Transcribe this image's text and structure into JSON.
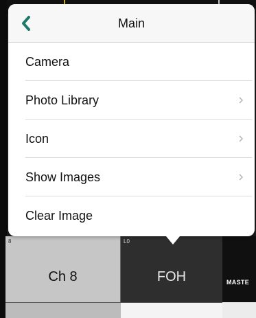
{
  "popover": {
    "title": "Main",
    "items": [
      {
        "label": "Camera",
        "has_submenu": false
      },
      {
        "label": "Photo Library",
        "has_submenu": true
      },
      {
        "label": "Icon",
        "has_submenu": true
      },
      {
        "label": "Show Images",
        "has_submenu": true
      },
      {
        "label": "Clear Image",
        "has_submenu": false
      }
    ]
  },
  "channels": [
    {
      "number": "8",
      "label": "Ch 8"
    },
    {
      "number": "L0",
      "label": "FOH"
    },
    {
      "label": "MASTE"
    }
  ],
  "colors": {
    "back_accent": "#1f7a6a",
    "chevron": "#b5b5b5"
  }
}
